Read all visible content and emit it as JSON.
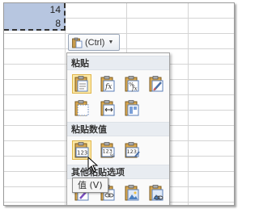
{
  "sheet": {
    "cells": [
      "14",
      "8"
    ]
  },
  "paste_options_button": {
    "label": "(Ctrl)",
    "icon": "clipboard-icon"
  },
  "paste_menu": {
    "sections": [
      {
        "title": "粘贴",
        "items": [
          {
            "name": "paste-icon"
          },
          {
            "name": "paste-formulas-icon"
          },
          {
            "name": "paste-formulas-number-format-icon"
          },
          {
            "name": "keep-source-formatting-icon"
          },
          {
            "name": "no-borders-icon"
          },
          {
            "name": "keep-column-widths-icon"
          },
          {
            "name": "transpose-icon"
          }
        ]
      },
      {
        "title": "粘贴数值",
        "items": [
          {
            "name": "paste-values-icon"
          },
          {
            "name": "values-number-format-icon"
          },
          {
            "name": "values-source-formatting-icon"
          }
        ]
      },
      {
        "title": "其他粘贴选项",
        "items": [
          {
            "name": "formatting-icon"
          },
          {
            "name": "paste-link-icon"
          },
          {
            "name": "picture-icon"
          },
          {
            "name": "linked-picture-icon"
          }
        ]
      }
    ],
    "tooltip": "值 (V)"
  }
}
